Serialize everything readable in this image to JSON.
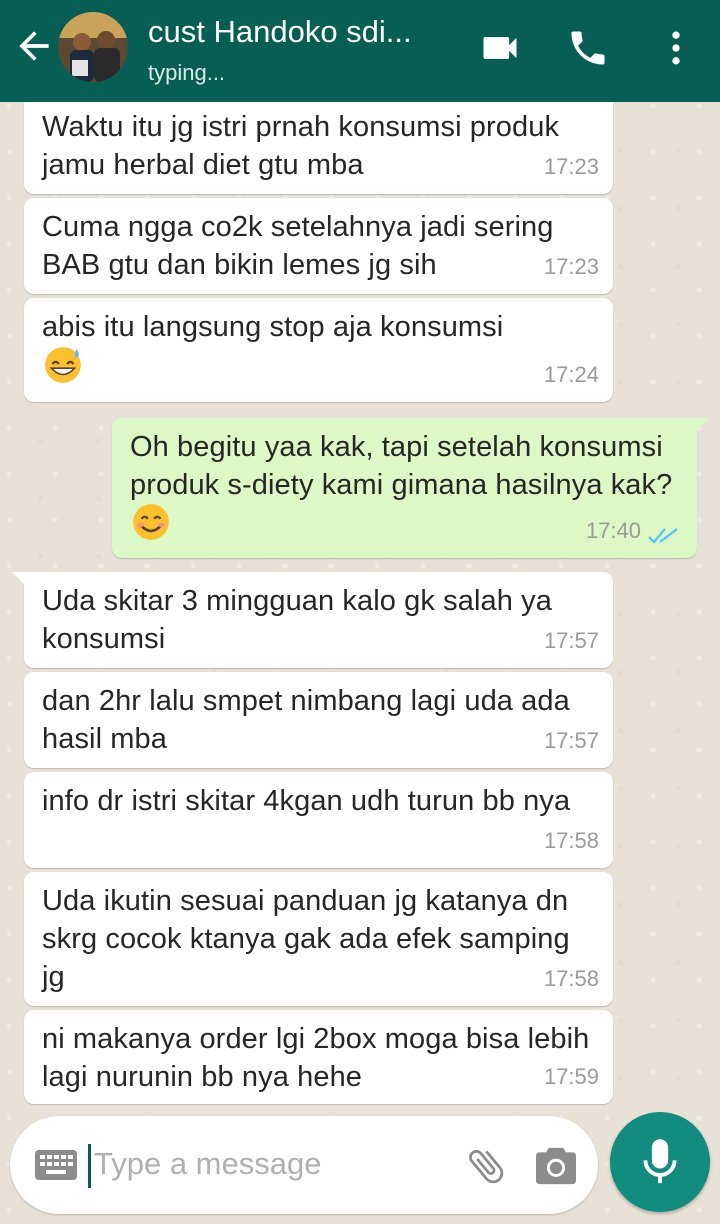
{
  "header": {
    "contact_name": "cust Handoko sdi...",
    "status": "typing..."
  },
  "icons": {
    "back": "arrow-left-icon",
    "video": "video-call-icon",
    "call": "phone-icon",
    "menu": "more-vert-icon",
    "keyboard": "keyboard-icon",
    "attach": "paperclip-icon",
    "camera": "camera-icon",
    "mic": "microphone-icon"
  },
  "colors": {
    "header_bg": "#075e54",
    "outgoing_bubble": "#dcf8c6",
    "incoming_bubble": "#ffffff",
    "mic_button": "#128c7e",
    "read_ticks": "#4fc3f7"
  },
  "messages": [
    {
      "dir": "in",
      "text": "Waktu itu jg istri prnah konsumsi produk jamu herbal diet gtu mba",
      "time": "17:23"
    },
    {
      "dir": "in",
      "text": "Cuma ngga co2k setelahnya jadi sering BAB gtu dan bikin lemes jg sih",
      "time": "17:23"
    },
    {
      "dir": "in",
      "text": "abis itu langsung stop aja konsumsi",
      "emoji": "sweat-smile-emoji",
      "time": "17:24"
    },
    {
      "dir": "out",
      "text": "Oh begitu yaa kak, tapi setelah konsumsi produk s-diety kami gimana hasilnya kak?",
      "emoji": "smiling-emoji",
      "time": "17:40",
      "status": "read"
    },
    {
      "dir": "in",
      "text": "Uda skitar 3 mingguan kalo gk salah ya konsumsi",
      "time": "17:57"
    },
    {
      "dir": "in",
      "text": "dan 2hr lalu smpet nimbang lagi uda ada hasil mba",
      "time": "17:57"
    },
    {
      "dir": "in",
      "text": "info dr istri skitar 4kgan udh turun bb nya",
      "time": "17:58"
    },
    {
      "dir": "in",
      "text": "Uda ikutin sesuai panduan jg katanya dn skrg cocok ktanya gak ada efek samping jg",
      "time": "17:58"
    },
    {
      "dir": "in",
      "text": "ni makanya order lgi 2box moga bisa lebih lagi nurunin bb nya hehe",
      "time": "17:59"
    }
  ],
  "composer": {
    "placeholder": "Type a message"
  }
}
